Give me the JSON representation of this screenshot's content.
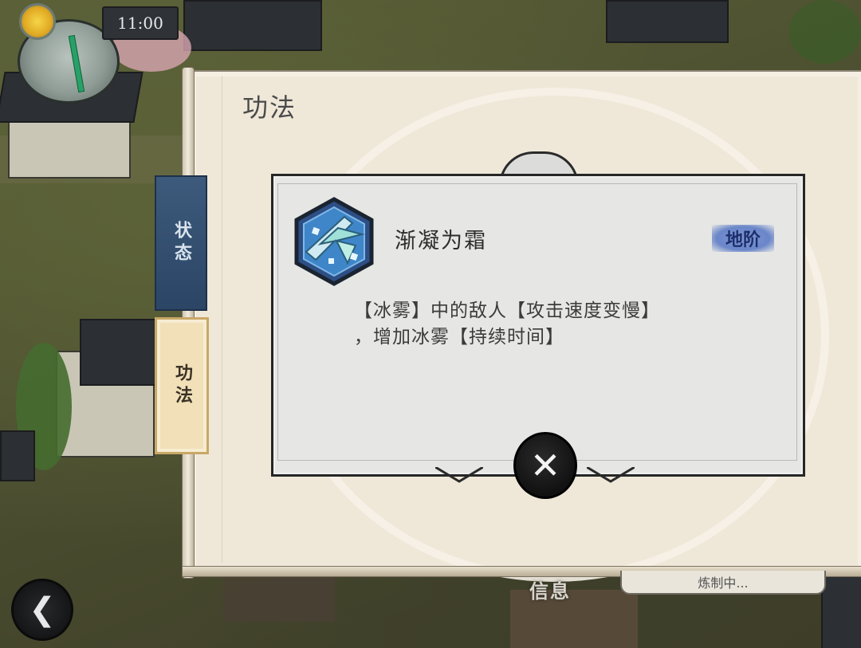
{
  "hud": {
    "time": "11:00"
  },
  "panel": {
    "title": "功法"
  },
  "tabs": [
    {
      "label": "状态",
      "active": false
    },
    {
      "label": "功法",
      "active": true
    }
  ],
  "skill": {
    "name": "渐凝为霜",
    "grade": "地阶",
    "description_line1": "【冰雾】中的敌人【攻击速度变慢】",
    "description_line2": "，增加冰雾【持续时间】",
    "icon": "ice-crystal-icon"
  },
  "bottom": {
    "info_label": "信息",
    "crafting_status": "炼制中..."
  },
  "colors": {
    "tab_status": "#2b4565",
    "tab_gongfa": "#f1e0b8",
    "grade_badge": "#6a86c9",
    "panel": "#efe8d9",
    "dialog": "#e6e6e4"
  }
}
